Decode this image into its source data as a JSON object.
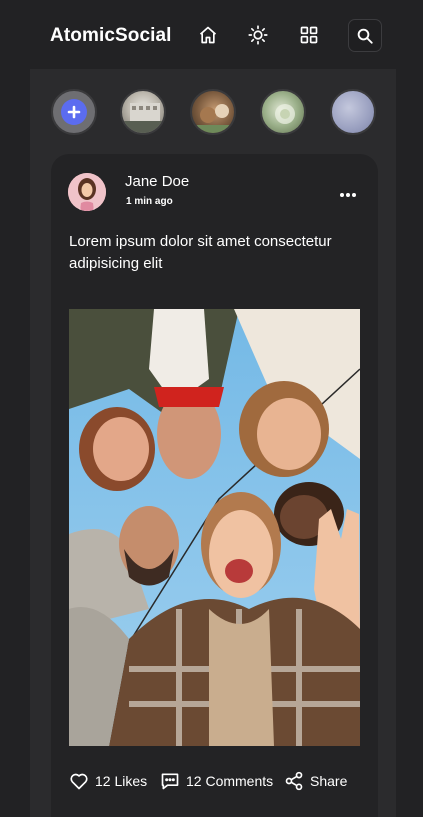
{
  "app": {
    "title": "AtomicSocial"
  },
  "header": {
    "icons": [
      "home-icon",
      "sun-icon",
      "grid-icon",
      "search-icon"
    ]
  },
  "stories": [
    {
      "type": "add",
      "icon": "plus-icon"
    },
    {
      "type": "story"
    },
    {
      "type": "story"
    },
    {
      "type": "story"
    },
    {
      "type": "story"
    }
  ],
  "post": {
    "author": "Jane Doe",
    "time": "1 min ago",
    "text": "Lorem ipsum dolor sit amet consectetur adipisicing elit",
    "actions": {
      "likes": "12 Likes",
      "comments": "12 Comments",
      "share": "Share"
    }
  },
  "colors": {
    "background": "#222224",
    "panel": "#2b2b2d",
    "card": "#232325",
    "accent": "#5b6cf0"
  }
}
